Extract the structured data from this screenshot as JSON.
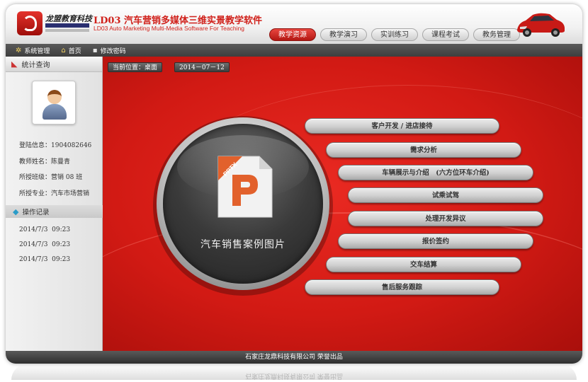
{
  "brand": {
    "company_name": "龙盟教育科技",
    "app_title": "LD03 汽车营销多媒体三维实景教学软件",
    "app_subtitle": "LD03 Auto Marketing Multi-Media Software For Teaching",
    "accent_color": "#d0201a"
  },
  "nav": {
    "tabs": [
      {
        "label": "教学资源",
        "active": true
      },
      {
        "label": "教学演习",
        "active": false
      },
      {
        "label": "实训练习",
        "active": false
      },
      {
        "label": "课程考试",
        "active": false
      },
      {
        "label": "教务管理",
        "active": false
      }
    ]
  },
  "toolbar": {
    "items": [
      {
        "label": "系统管理",
        "icon": "settings-icon"
      },
      {
        "label": "首页",
        "icon": "home-icon"
      },
      {
        "label": "修改密码",
        "icon": "lock-icon"
      }
    ]
  },
  "sidebar": {
    "stats_title": "统计查询",
    "info": [
      {
        "label": "登陆信息：",
        "value": "1904082646"
      },
      {
        "label": "教师姓名：",
        "value": "陈曼青"
      },
      {
        "label": "所授班级：",
        "value": "营销 08 班"
      },
      {
        "label": "所授专业：",
        "value": "汽车市场营销"
      }
    ],
    "ops_title": "操作记录",
    "ops": [
      {
        "date": "2014/7/3",
        "time": "09:23"
      },
      {
        "date": "2014/7/3",
        "time": "09:23"
      },
      {
        "date": "2014/7/3",
        "time": "09:23"
      }
    ]
  },
  "main": {
    "location_label": "当前位置：桌面",
    "date": "2014－07－12",
    "center_label": "汽车销售案例图片",
    "file_badge": "PPTX",
    "menu": [
      "客户开发 / 进店接待",
      "需求分析",
      "车辆展示与介绍　(六方位环车介绍)",
      "试乘试驾",
      "处理开发异议",
      "报价签约",
      "交车结算",
      "售后服务跟踪"
    ]
  },
  "footer": {
    "text": "石家庄龙鼎科技有限公司  荣誉出品"
  }
}
